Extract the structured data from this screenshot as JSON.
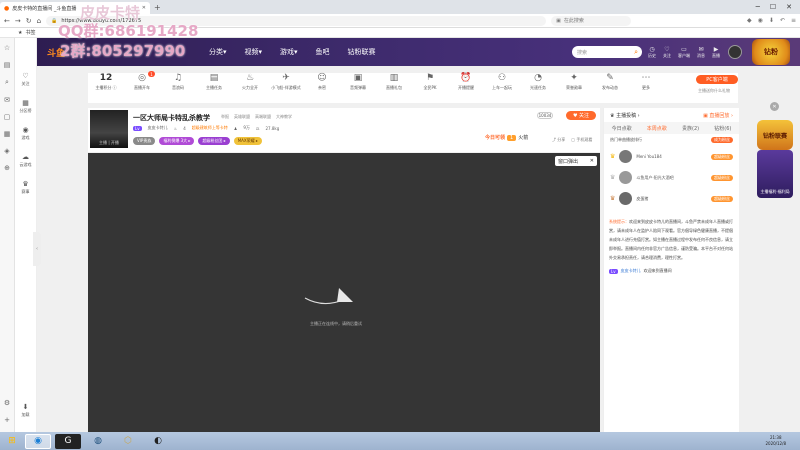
{
  "browser": {
    "tab_title": "皮皮卡特的直播间 _斗鱼直播",
    "new_tab": "+",
    "url_host": "https://www.douyu.com/",
    "url_path": "172675",
    "search_placeholder": "在此搜索",
    "bookmark_label": "书签"
  },
  "watermark": {
    "line1": "皮皮卡特",
    "line2": "QQ群:686191428",
    "line3": "2群:805297990"
  },
  "site_nav": {
    "items": [
      {
        "label": "关注",
        "icon": "♡"
      },
      {
        "label": "分区榜",
        "icon": "▦"
      },
      {
        "label": "游戏",
        "icon": "◉"
      },
      {
        "label": "云游戏",
        "icon": "☁"
      },
      {
        "label": "赛事",
        "icon": "♛"
      }
    ],
    "bottom_label": "加载"
  },
  "header": {
    "logo": "斗鱼",
    "menu": [
      "分类▾",
      "视频▾",
      "游戏▾",
      "鱼吧",
      "钻粉联赛"
    ],
    "search_placeholder": "搜索",
    "icons": [
      {
        "label": "历史",
        "icon": "◷"
      },
      {
        "label": "关注",
        "icon": "♡"
      },
      {
        "label": "客户端",
        "icon": "▭"
      },
      {
        "label": "消息",
        "icon": "✉"
      },
      {
        "label": "直播",
        "icon": "▶"
      }
    ],
    "promo_text": "钻粉"
  },
  "room_tools": {
    "hot_badge": "1",
    "items": [
      {
        "label": "主播积分 ⓘ",
        "icon": "12"
      },
      {
        "label": "直播开车",
        "icon": "◎"
      },
      {
        "label": "音浪码",
        "icon": "♫"
      },
      {
        "label": "主播任务",
        "icon": "▤"
      },
      {
        "label": "火力全开",
        "icon": "♨"
      },
      {
        "label": "小飞船-伴游模式",
        "icon": "✈"
      },
      {
        "label": "亲密",
        "icon": "☺"
      },
      {
        "label": "音频弹幕",
        "icon": "▣"
      },
      {
        "label": "直播礼包",
        "icon": "▥"
      },
      {
        "label": "全民PK",
        "icon": "⚑"
      },
      {
        "label": "开播提醒",
        "icon": "⏰"
      },
      {
        "label": "上车一起玩",
        "icon": "⚇"
      },
      {
        "label": "光速任务",
        "icon": "◔"
      },
      {
        "label": "荣誉勋章",
        "icon": "✦"
      },
      {
        "label": "发布动态",
        "icon": "✎"
      },
      {
        "label": "更多",
        "icon": "⋯"
      }
    ],
    "pc_button": "PC客户端",
    "pc_sub": "主播送你什么礼物"
  },
  "streamer": {
    "title": "一区大师局卡特乱杀教学",
    "tags": [
      "举报",
      "英雄联盟",
      "高端联盟",
      "大神教学"
    ],
    "name_level": "Lv",
    "name": "皮皮卡特儿",
    "heat": "4",
    "warn": "超级建筑师上等卡特",
    "fans": "9万",
    "weight": "27.8kg",
    "thumb_caption": "主播 | 开播",
    "badges": [
      "VIP贵族",
      "福利倒爆 3大 ▸",
      "超级粉丝团 ▸",
      "MAX荣耀 ▸"
    ],
    "follow_count": "10034",
    "follow_button": "♥ 关注",
    "rank_label": "今日可领",
    "rank_num": "1",
    "rank_unit": "火箭",
    "share": "⤴ 分享",
    "mobile": "▢ 手机观看"
  },
  "video": {
    "popout_label": "窗口弹出",
    "popout_close": "✕",
    "loading_text": "主播正在连线中，请稍后重试"
  },
  "right_panel": {
    "top_left": "♛ 主播投稿 ›",
    "top_right": "▣ 直播回放 ›",
    "tabs": [
      "今日点歌",
      "本周点歌",
      "贵族(2)",
      "钻粉(6)"
    ],
    "sub_title": "热门单曲播放排行",
    "sub_btn": "成为粉丝",
    "ranks": [
      {
        "name": "Meni You184",
        "badge": "超级粉丝"
      },
      {
        "name": "斗鱼用户·阳光大酒吧",
        "badge": "超级粉丝"
      },
      {
        "name": "皮蛋猪",
        "badge": "超级粉丝"
      }
    ],
    "sys_tag": "系统提示：",
    "sys_text": "欢迎来到皮皮卡特儿的直播间，斗鱼严禁未成年人直播或打赏，请未成年人在监护人陪同下观看。官方倡导绿色健康直播，不提倡未成年人进行充值打赏。如主播在直播过程中发布任何不良信息，请立即举报。直播间内任何非官方广告信息，谨防受骗。本平台不对任何站外交易承担责任，请合理消费，理性打赏。",
    "welcome_lvl": "Lv",
    "welcome_name": "皮皮卡特儿",
    "welcome_text": "欢迎来到直播间"
  },
  "float_promo": {
    "label": "钻粉联赛",
    "char_label": "主播福利·福利局",
    "close": "✕"
  },
  "taskbar": {
    "time": "21:38",
    "date": "2020/12/8"
  }
}
